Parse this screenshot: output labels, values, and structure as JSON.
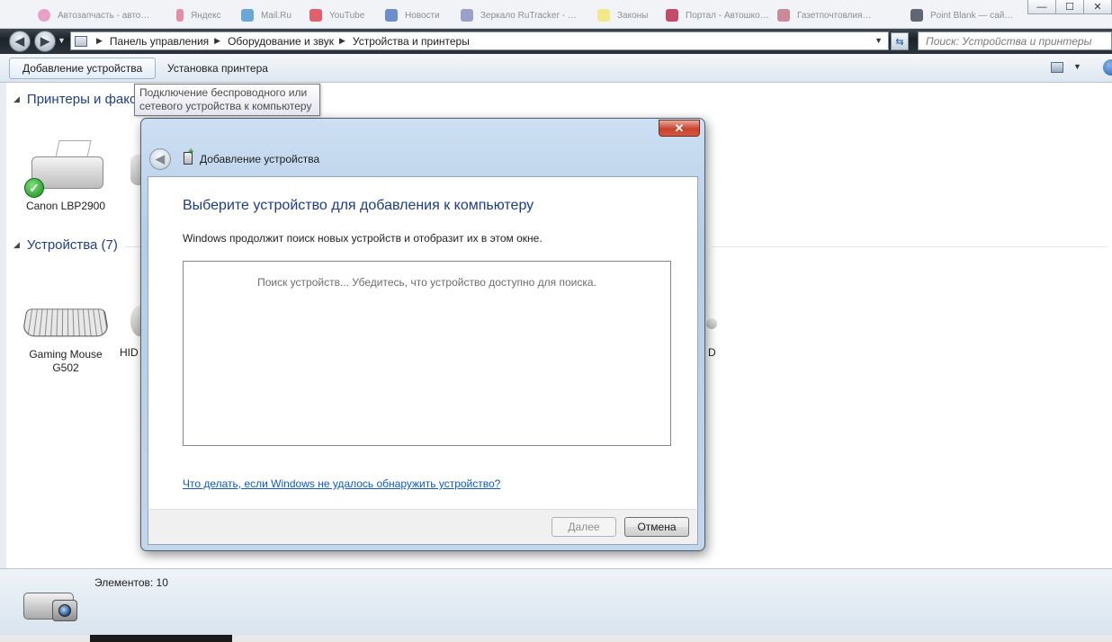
{
  "bookmarks": [
    {
      "label": "Автозапчасть - авто…",
      "color": "#e6a1c9"
    },
    {
      "label": "Яндекс",
      "color": "#e48ea6"
    },
    {
      "label": "Mail.Ru",
      "color": "#6aa6d6"
    },
    {
      "label": "YouTube",
      "color": "#e0616b"
    },
    {
      "label": "Новости",
      "color": "#6d8cc9"
    },
    {
      "label": "Зеркало RuTracker - …",
      "color": "#9aa0c9"
    },
    {
      "label": "Законы",
      "color": "#f2ea8a"
    },
    {
      "label": "Портал - Автошко…",
      "color": "#c24a6a"
    },
    {
      "label": "Газетпочтовлия…",
      "color": "#c98a9a"
    },
    {
      "label": "Point Blank — сай…",
      "color": "#5f6674"
    }
  ],
  "window_controls": {
    "minimize": "—",
    "maximize": "☐",
    "close": "✕"
  },
  "address": {
    "back": "◀",
    "forward": "▶",
    "crumbs": [
      "Панель управления",
      "Оборудование и звук",
      "Устройства и принтеры"
    ],
    "search_placeholder": "Поиск: Устройства и принтеры"
  },
  "commandbar": {
    "add_device": "Добавление устройства",
    "add_printer": "Установка принтера"
  },
  "tooltip": {
    "line1": "Подключение беспроводного или",
    "line2": "сетевого устройства к компьютеру"
  },
  "groups": {
    "printers": {
      "title": "Принтеры и факсы",
      "items": [
        {
          "label": "Canon LBP2900"
        }
      ]
    },
    "devices": {
      "title": "Устройства (7)",
      "items": [
        {
          "label": "Gaming Mouse G502"
        },
        {
          "label": "HID"
        },
        {
          "label": "D"
        }
      ]
    }
  },
  "dialog": {
    "title": "Добавление устройства",
    "heading": "Выберите устройство для добавления к компьютеру",
    "description": "Windows продолжит поиск новых устройств и отобразит их в этом окне.",
    "searching": "Поиск устройств... Убедитесь, что устройство доступно для поиска.",
    "help_link": "Что делать, если Windows не удалось обнаружить устройство?",
    "next": "Далее",
    "cancel": "Отмена",
    "close_glyph": "✕"
  },
  "details": {
    "count": "Элементов: 10"
  },
  "colors": {
    "accent": "#1e3f8a",
    "link": "#0e5ac2",
    "close_red": "#c7432d"
  }
}
